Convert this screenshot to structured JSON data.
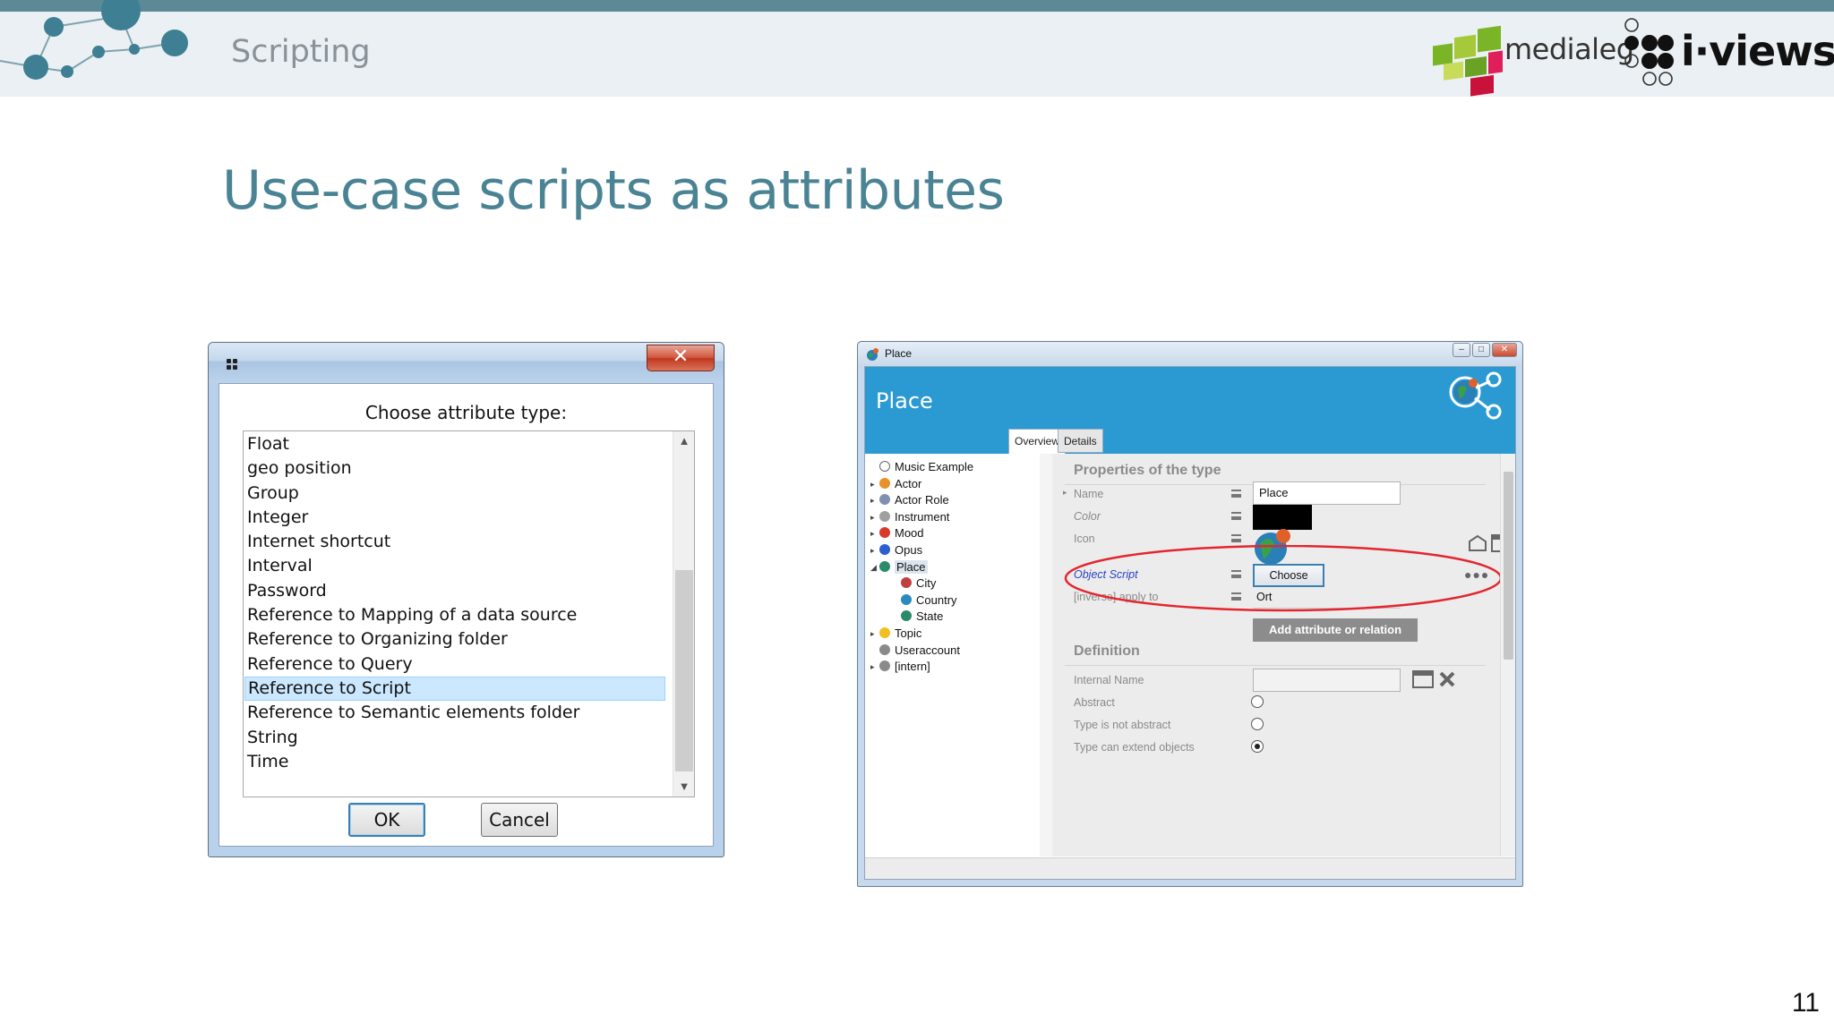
{
  "header": {
    "section_title": "Scripting",
    "medialeg_text": "medialeg",
    "iviews_text": "i·views"
  },
  "slide": {
    "title": "Use-case scripts as attributes",
    "page_number": "11"
  },
  "dialog1": {
    "close_label": "✕",
    "prompt": "Choose attribute type:",
    "items": [
      "Float",
      "geo position",
      "Group",
      "Integer",
      "Internet shortcut",
      "Interval",
      "Password",
      "Reference to Mapping of a data source",
      "Reference to Organizing folder",
      "Reference to Query",
      "Reference to Script",
      "Reference to Semantic elements folder",
      "String",
      "Time"
    ],
    "selected_index": 10,
    "ok_label": "OK",
    "cancel_label": "Cancel"
  },
  "place_window": {
    "caption": "Place",
    "banner_title": "Place",
    "tabs": [
      "Overview",
      "Details"
    ],
    "tree": [
      {
        "label": "Music Example",
        "expander": "",
        "icon": "circle-outline",
        "color": "#ffffff"
      },
      {
        "label": "Actor",
        "expander": "▸",
        "icon": "actor-icon",
        "color": "#e8902a"
      },
      {
        "label": "Actor Role",
        "expander": "▸",
        "icon": "actor-role-icon",
        "color": "#8090b0"
      },
      {
        "label": "Instrument",
        "expander": "▸",
        "icon": "instrument-icon",
        "color": "#a0a0a0"
      },
      {
        "label": "Mood",
        "expander": "▸",
        "icon": "heart-icon",
        "color": "#d83a2a"
      },
      {
        "label": "Opus",
        "expander": "▸",
        "icon": "music-note-icon",
        "color": "#2a5fd0"
      },
      {
        "label": "Place",
        "expander": "◢",
        "icon": "globe-icon",
        "color": "#2a8a6a"
      },
      {
        "label": "City",
        "expander": "",
        "icon": "city-icon",
        "color": "#c04040"
      },
      {
        "label": "Country",
        "expander": "",
        "icon": "country-icon",
        "color": "#2a8ac0"
      },
      {
        "label": "State",
        "expander": "",
        "icon": "state-icon",
        "color": "#2a8a6a"
      },
      {
        "label": "Topic",
        "expander": "▸",
        "icon": "bulb-icon",
        "color": "#f0c020"
      },
      {
        "label": "Useraccount",
        "expander": "",
        "icon": "circle-gray",
        "color": "#8a8a8a"
      },
      {
        "label": "[intern]",
        "expander": "▸",
        "icon": "circle-gray",
        "color": "#8a8a8a"
      }
    ],
    "selected_tree_index": 6,
    "properties": {
      "heading": "Properties of the type",
      "name_label": "Name",
      "name_value": "Place",
      "color_label": "Color",
      "icon_label": "Icon",
      "object_script_label": "Object Script",
      "choose_label": "Choose",
      "inverse_label": "[inverse] apply to",
      "inverse_value": "Ort",
      "add_button": "Add attribute or relation",
      "more_label": "●●●"
    },
    "definition": {
      "heading": "Definition",
      "internal_name_label": "Internal Name",
      "internal_name_value": "",
      "abstract_label": "Abstract",
      "not_abstract_label": "Type is not abstract",
      "extend_label": "Type can extend objects",
      "abstract_checked": false,
      "not_abstract_checked": false,
      "extend_checked": true
    },
    "highlight_color": "#e3262e"
  }
}
